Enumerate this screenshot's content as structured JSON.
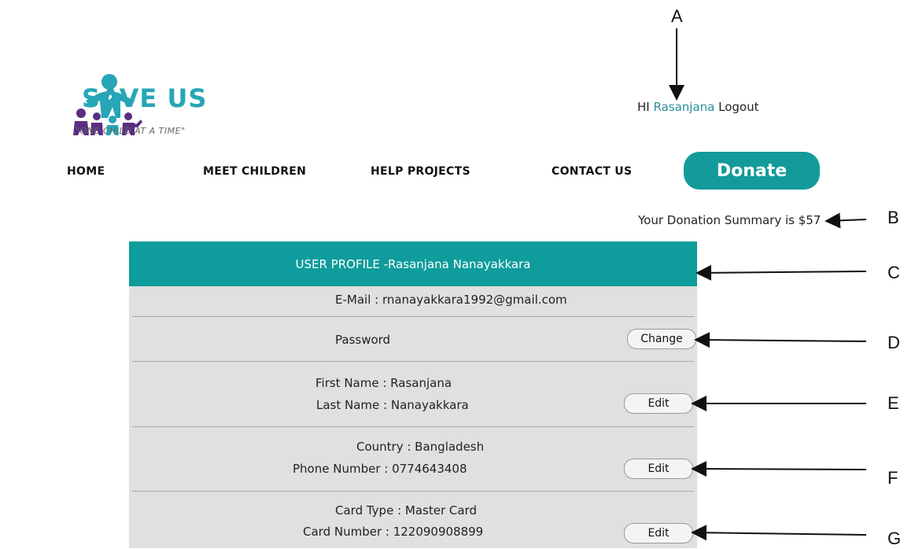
{
  "logo": {
    "title": "SAVE US",
    "tagline": "\"ONE CHILD AT A TIME\""
  },
  "header": {
    "greeting_prefix": "HI",
    "username": "Rasanjana",
    "logout_label": "Logout"
  },
  "nav": {
    "items": [
      "HOME",
      "MEET CHILDREN",
      "HELP PROJECTS",
      "CONTACT US"
    ],
    "donate_label": "Donate"
  },
  "summary": "Your Donation Summary is $57",
  "profile": {
    "header": "USER PROFILE -Rasanjana Nanayakkara",
    "email": "E-Mail : rnanayakkara1992@gmail.com",
    "password_label": "Password",
    "change_label": "Change",
    "first_name": "First Name : Rasanjana",
    "last_name": "Last Name : Nanayakkara",
    "country": "Country : Bangladesh",
    "phone": "Phone Number : 0774643408",
    "card_type": "Card Type : Master Card",
    "card_number": "Card Number : 122090908899",
    "edit_label": "Edit"
  },
  "annotations": [
    "A",
    "B",
    "C",
    "D",
    "E",
    "F",
    "G"
  ],
  "colors": {
    "teal": "#0f9c9c",
    "logo_blue": "#26a6b6",
    "logo_purple": "#5a2d82"
  }
}
